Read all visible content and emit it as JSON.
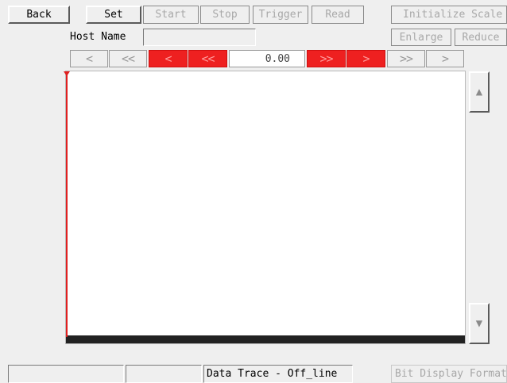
{
  "toolbar": {
    "back": "Back",
    "set": "Set",
    "start": "Start",
    "stop": "Stop",
    "trigger": "Trigger",
    "read": "Read",
    "initialize_scale": "Initialize Scale",
    "enlarge": "Enlarge",
    "reduce": "Reduce"
  },
  "host": {
    "label": "Host Name",
    "value": ""
  },
  "navigator": {
    "prev_grey": "<",
    "prev_fast_grey": "<<",
    "prev_red": "<",
    "prev_fast_red": "<<",
    "position": "0.00",
    "next_fast_red": ">>",
    "next_red": ">",
    "next_fast_grey": ">>",
    "next_grey": ">"
  },
  "scroll": {
    "up_arrow": "▲",
    "down_arrow": "▼"
  },
  "status": {
    "field1": "",
    "field2": "",
    "title": "Data Trace - Off_line",
    "bit_display": "Bit Display Format"
  },
  "colors": {
    "accent_red": "#ee2020",
    "trace_bar": "#222222",
    "cursor": "#e02020"
  },
  "icons": {
    "cursor_marker": "cursor-marker-icon"
  }
}
